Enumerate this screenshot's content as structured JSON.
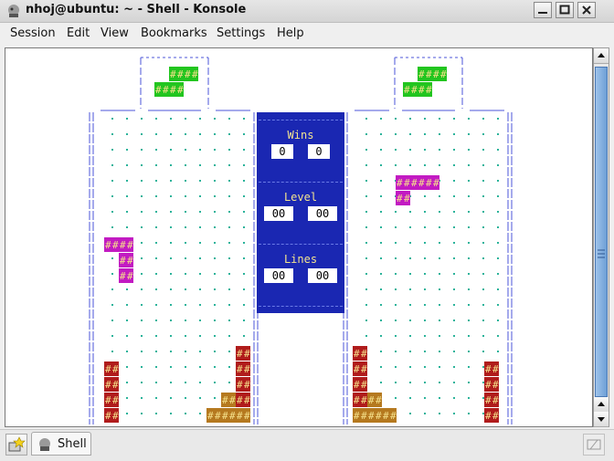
{
  "window": {
    "title": "nhoj@ubuntu: ~ - Shell - Konsole"
  },
  "menubar": {
    "items": [
      "Session",
      "Edit",
      "View",
      "Bookmarks",
      "Settings",
      "Help"
    ]
  },
  "game": {
    "panel": {
      "wins_label": "Wins",
      "wins_left": "0",
      "wins_right": "0",
      "level_label": "Level",
      "level_left": "00",
      "level_right": "00",
      "lines_label": "Lines",
      "lines_left": "00",
      "lines_right": "00"
    },
    "block_char": "#",
    "colors": {
      "green": "#22c51f",
      "magenta": "#c21bc2",
      "red": "#b01c1c",
      "orange": "#b5791f",
      "block_text": "#f5e08a",
      "dot": "#2bb39a",
      "frame": "#4b55d8"
    }
  },
  "taskbar": {
    "tab_label": "Shell"
  },
  "icons": {
    "app": "konsole-shell-icon",
    "minimize": "minimize-icon",
    "maximize": "maximize-icon",
    "close": "close-icon",
    "new_tab": "new-tab-icon",
    "close_tab": "close-tab-icon",
    "scroll_up": "scroll-up-icon",
    "scroll_down": "scroll-down-icon"
  }
}
